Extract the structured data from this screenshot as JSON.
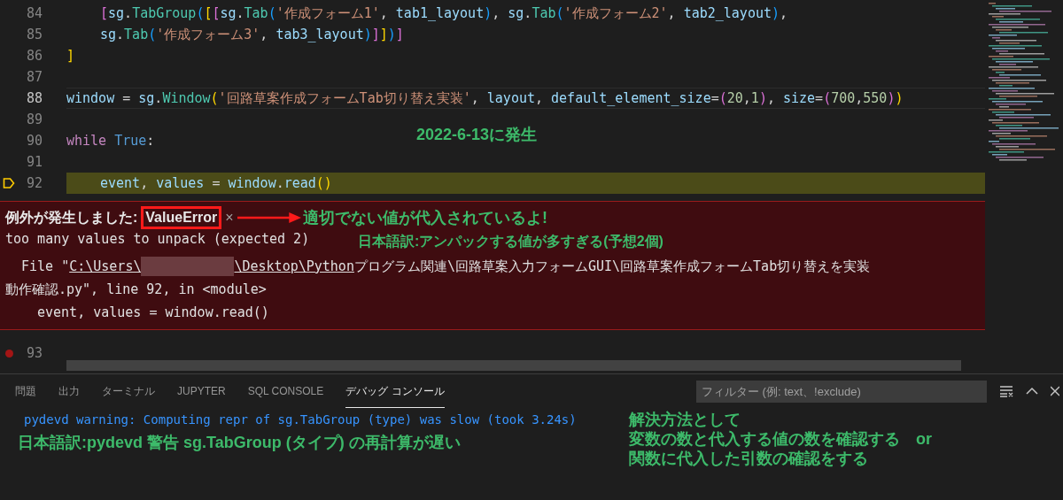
{
  "editor": {
    "lines": [
      {
        "number": "84",
        "active": false,
        "kind": "plain",
        "indented": true,
        "tokens": [
          {
            "text": "[",
            "kind": "b2"
          },
          {
            "text": "sg",
            "kind": "v"
          },
          {
            "text": ".",
            "kind": "p"
          },
          {
            "text": "TabGroup",
            "kind": "f"
          },
          {
            "text": "(",
            "kind": "b3"
          },
          {
            "text": "[",
            "kind": "b1"
          },
          {
            "text": "[",
            "kind": "b2"
          },
          {
            "text": "sg",
            "kind": "v"
          },
          {
            "text": ".",
            "kind": "p"
          },
          {
            "text": "Tab",
            "kind": "f"
          },
          {
            "text": "(",
            "kind": "b3"
          },
          {
            "text": "'作成フォーム1'",
            "kind": "s"
          },
          {
            "text": ", ",
            "kind": "p"
          },
          {
            "text": "tab1_layout",
            "kind": "v"
          },
          {
            "text": ")",
            "kind": "b3"
          },
          {
            "text": ", ",
            "kind": "p"
          },
          {
            "text": "sg",
            "kind": "v"
          },
          {
            "text": ".",
            "kind": "p"
          },
          {
            "text": "Tab",
            "kind": "f"
          },
          {
            "text": "(",
            "kind": "b3"
          },
          {
            "text": "'作成フォーム2'",
            "kind": "s"
          },
          {
            "text": ", ",
            "kind": "p"
          },
          {
            "text": "tab2_layout",
            "kind": "v"
          },
          {
            "text": ")",
            "kind": "b3"
          },
          {
            "text": ",",
            "kind": "p"
          }
        ]
      },
      {
        "number": "85",
        "active": false,
        "kind": "plain",
        "indented": true,
        "tokens": [
          {
            "text": "sg",
            "kind": "v"
          },
          {
            "text": ".",
            "kind": "p"
          },
          {
            "text": "Tab",
            "kind": "f"
          },
          {
            "text": "(",
            "kind": "b3"
          },
          {
            "text": "'作成フォーム3'",
            "kind": "s"
          },
          {
            "text": ", ",
            "kind": "p"
          },
          {
            "text": "tab3_layout",
            "kind": "v"
          },
          {
            "text": ")",
            "kind": "b3"
          },
          {
            "text": "]",
            "kind": "b2"
          },
          {
            "text": "]",
            "kind": "b1"
          },
          {
            "text": ")",
            "kind": "b3"
          },
          {
            "text": "]",
            "kind": "b2"
          }
        ]
      },
      {
        "number": "86",
        "active": false,
        "kind": "plain",
        "indented": false,
        "tokens": [
          {
            "text": "]",
            "kind": "b1"
          }
        ]
      },
      {
        "number": "87",
        "active": false,
        "kind": "plain"
      },
      {
        "number": "88",
        "active": true,
        "kind": "plain",
        "indented": false,
        "tokens": [
          {
            "text": "window",
            "kind": "v"
          },
          {
            "text": " = ",
            "kind": "p"
          },
          {
            "text": "sg",
            "kind": "v"
          },
          {
            "text": ".",
            "kind": "p"
          },
          {
            "text": "Window",
            "kind": "f"
          },
          {
            "text": "(",
            "kind": "b1"
          },
          {
            "text": "'回路草案作成フォームTab切り替え実装'",
            "kind": "s"
          },
          {
            "text": ", ",
            "kind": "p"
          },
          {
            "text": "layout",
            "kind": "v"
          },
          {
            "text": ", ",
            "kind": "p"
          },
          {
            "text": "default_element_size",
            "kind": "v"
          },
          {
            "text": "=",
            "kind": "p"
          },
          {
            "text": "(",
            "kind": "b2"
          },
          {
            "text": "20",
            "kind": "n"
          },
          {
            "text": ",",
            "kind": "p"
          },
          {
            "text": "1",
            "kind": "n"
          },
          {
            "text": ")",
            "kind": "b2"
          },
          {
            "text": ", ",
            "kind": "p"
          },
          {
            "text": "size",
            "kind": "v"
          },
          {
            "text": "=",
            "kind": "p"
          },
          {
            "text": "(",
            "kind": "b2"
          },
          {
            "text": "700",
            "kind": "n"
          },
          {
            "text": ",",
            "kind": "p"
          },
          {
            "text": "550",
            "kind": "n"
          },
          {
            "text": ")",
            "kind": "b2"
          },
          {
            "text": ")",
            "kind": "b1"
          }
        ]
      },
      {
        "number": "89",
        "active": false,
        "kind": "plain"
      },
      {
        "number": "90",
        "active": false,
        "kind": "plain",
        "indented": false,
        "tokens": [
          {
            "text": "while",
            "kind": "k"
          },
          {
            "text": " True",
            "kind": "c"
          },
          {
            "text": ":",
            "kind": "p"
          }
        ]
      },
      {
        "number": "91",
        "active": false,
        "kind": "plain"
      },
      {
        "number": "92",
        "active": false,
        "kind": "paused",
        "indented": true,
        "tokens": [
          {
            "text": "event",
            "kind": "v"
          },
          {
            "text": ", ",
            "kind": "p"
          },
          {
            "text": "values",
            "kind": "v"
          },
          {
            "text": " = ",
            "kind": "p"
          },
          {
            "text": "window",
            "kind": "v"
          },
          {
            "text": ".",
            "kind": "p"
          },
          {
            "text": "read",
            "kind": "v"
          },
          {
            "text": "()",
            "kind": "b1"
          }
        ]
      }
    ],
    "exception": {
      "title": "例外が発生しました:",
      "error_name": "ValueError",
      "close": "×",
      "message": "too many values to unpack (expected 2)",
      "file_prefix": "File \"",
      "link_start": "C:\\Users\\",
      "link_end": "\\Desktop\\Python",
      "path_rest": "プログラム関連\\回路草案入力フォームGUI\\回路草案作成フォームTab切り替えを実装",
      "trace_lines": [
        "動作確認.py\", line 92, in <module>",
        "event, values = window.read()"
      ]
    },
    "after_lines": [
      {
        "number": "93",
        "active": false,
        "kind": "breakpoint"
      }
    ]
  },
  "annotations": {
    "date_note": "2022-6-13に発生",
    "error_note": "適切でない値が代入されているよ!",
    "translation_note": "日本語訳:アンパックする値が多すぎる(予想2個)",
    "warning_translation": "日本語訳:pydevd 警告 sg.TabGroup (タイプ) の再計算が遅い",
    "solution_lines": [
      "解決方法として",
      "変数の数と代入する値の数を確認する　or",
      "関数に代入した引数の確認をする"
    ]
  },
  "panel": {
    "tabs": [
      {
        "label": "問題",
        "selected": false
      },
      {
        "label": "出力",
        "selected": false
      },
      {
        "label": "ターミナル",
        "selected": false
      },
      {
        "label": "JUPYTER",
        "selected": false
      },
      {
        "label": "SQL CONSOLE",
        "selected": false
      },
      {
        "label": "デバッグ コンソール",
        "selected": true
      }
    ],
    "filter": {
      "placeholder": "フィルター (例: text、!exclude)"
    },
    "console_lines": [
      "pydevd warning: Computing repr of sg.TabGroup (type) was slow (took 3.24s)"
    ]
  }
}
